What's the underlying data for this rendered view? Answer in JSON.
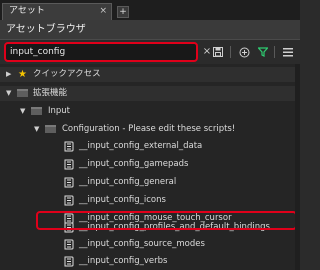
{
  "tab": {
    "label": "アセット",
    "close": "×",
    "add": "+"
  },
  "header": {
    "title": "アセットブラウザ"
  },
  "search": {
    "value": "input_config",
    "placeholder": "",
    "clear": "×"
  },
  "toolbar": {
    "save": "💾",
    "add": "⊕",
    "filter": "▼",
    "menu": "≡"
  },
  "tree": {
    "quick_access": "クイックアクセス",
    "extensions": "拡張機能",
    "input": "Input",
    "configuration": "Configuration - Please edit these scripts!",
    "scripts": [
      "__input_config_external_data",
      "__input_config_gamepads",
      "__input_config_general",
      "__input_config_icons",
      "__input_config_mouse_touch_cursor",
      "__input_config_profiles_and_default_bindings",
      "__input_config_source_modes",
      "__input_config_verbs"
    ]
  },
  "colors": {
    "highlight": "#e0001a",
    "filter_icon": "#2ecc71",
    "star": "#f5c400"
  }
}
